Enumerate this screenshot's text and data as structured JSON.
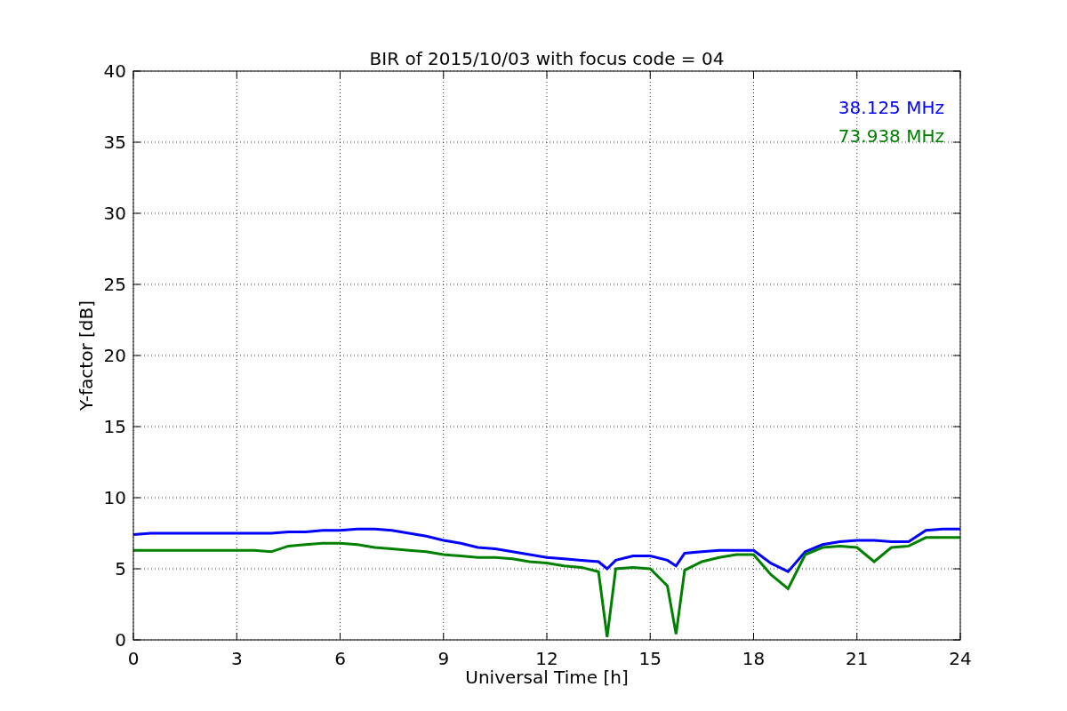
{
  "chart_data": {
    "type": "line",
    "title": "BIR of 2015/10/03 with focus code = 04",
    "xlabel": "Universal Time [h]",
    "ylabel": "Y-factor [dB]",
    "xlim": [
      0,
      24
    ],
    "ylim": [
      0,
      40
    ],
    "xticks": [
      0,
      3,
      6,
      9,
      12,
      15,
      18,
      21,
      24
    ],
    "yticks": [
      0,
      5,
      10,
      15,
      20,
      25,
      30,
      35,
      40
    ],
    "grid": true,
    "x": [
      0,
      0.5,
      1,
      1.5,
      2,
      2.5,
      3,
      3.5,
      4,
      4.5,
      5,
      5.5,
      6,
      6.5,
      7,
      7.5,
      8,
      8.5,
      9,
      9.5,
      10,
      10.5,
      11,
      11.5,
      12,
      12.5,
      13,
      13.5,
      13.75,
      14,
      14.5,
      15,
      15.5,
      15.75,
      16,
      16.5,
      17,
      17.5,
      18,
      18.5,
      19,
      19.5,
      20,
      20.5,
      21,
      21.5,
      22,
      22.5,
      23,
      23.5,
      24
    ],
    "series": [
      {
        "name": "38.125 MHz",
        "color": "#0000ff",
        "values": [
          7.4,
          7.5,
          7.5,
          7.5,
          7.5,
          7.5,
          7.5,
          7.5,
          7.5,
          7.6,
          7.6,
          7.7,
          7.7,
          7.8,
          7.8,
          7.7,
          7.5,
          7.3,
          7.0,
          6.8,
          6.5,
          6.4,
          6.2,
          6.0,
          5.8,
          5.7,
          5.6,
          5.5,
          5.0,
          5.6,
          5.9,
          5.9,
          5.6,
          5.2,
          6.1,
          6.2,
          6.3,
          6.3,
          6.3,
          5.4,
          4.8,
          6.2,
          6.7,
          6.9,
          7.0,
          7.0,
          6.9,
          6.9,
          7.7,
          7.8,
          7.8
        ]
      },
      {
        "name": "73.938 MHz",
        "color": "#008000",
        "values": [
          6.3,
          6.3,
          6.3,
          6.3,
          6.3,
          6.3,
          6.3,
          6.3,
          6.2,
          6.6,
          6.7,
          6.8,
          6.8,
          6.7,
          6.5,
          6.4,
          6.3,
          6.2,
          6.0,
          5.9,
          5.8,
          5.8,
          5.7,
          5.5,
          5.4,
          5.2,
          5.1,
          4.8,
          0.2,
          5.0,
          5.1,
          5.0,
          3.8,
          0.4,
          4.9,
          5.5,
          5.8,
          6.0,
          6.0,
          4.6,
          3.6,
          6.0,
          6.5,
          6.6,
          6.5,
          5.5,
          6.5,
          6.6,
          7.2,
          7.2,
          7.2
        ]
      }
    ]
  }
}
